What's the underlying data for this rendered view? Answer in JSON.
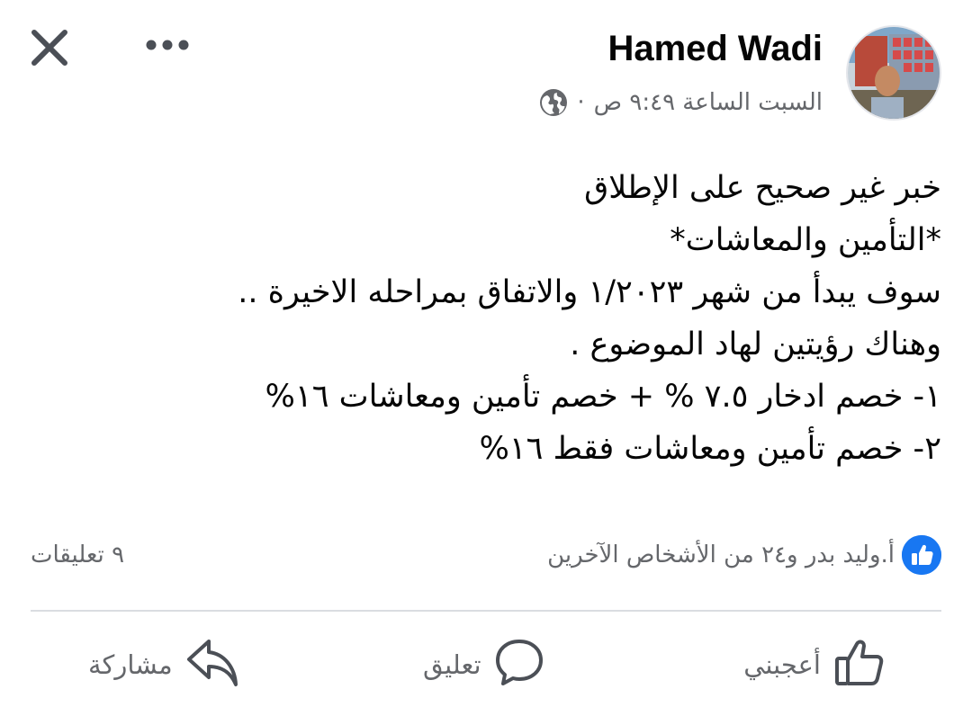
{
  "header": {
    "author_name": "Hamed Wadi",
    "timestamp": "السبت الساعة ٩:٤٩ ص",
    "separator": "·",
    "privacy_icon": "globe-icon",
    "close_icon": "close-icon",
    "more_icon": "more-dots-icon"
  },
  "post": {
    "lines": [
      "خبر غير صحيح على الإطلاق",
      "*التأمين والمعاشات*",
      "سوف يبدأ  من شهر ١/٢٠٢٣ والاتفاق بمراحله الاخيرة ..",
      "وهناك رؤيتين لهاد الموضوع .",
      "١- خصم ادخار ٧.٥ % + خصم تأمين ومعاشات ١٦%",
      "٢- خصم تأمين ومعاشات فقط ١٦%"
    ]
  },
  "engagement": {
    "reactions_text": "أ.وليد بدر و٢٤ من الأشخاص الآخرين",
    "comments_text": "٩ تعليقات"
  },
  "actions": {
    "like_label": "أعجبني",
    "comment_label": "تعليق",
    "share_label": "مشاركة"
  },
  "colors": {
    "text_primary": "#050505",
    "text_secondary": "#65676b",
    "like_blue": "#1877f2",
    "divider": "#dadde1"
  }
}
